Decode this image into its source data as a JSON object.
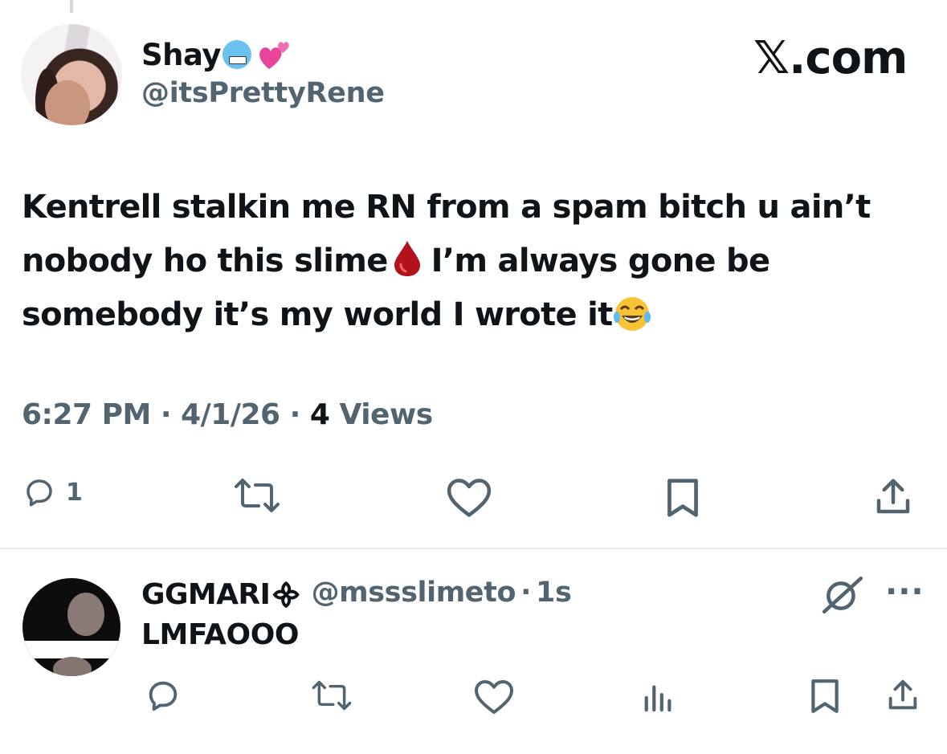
{
  "header": {
    "display_name": "Shay",
    "display_name_emojis": [
      "cold-face-emoji",
      "two-hearts-emoji"
    ],
    "handle": "@itsPrettyRene",
    "watermark": "𝕏.com"
  },
  "tweet": {
    "lines": [
      "Kentrell stalkin me RN from a spam bitch u ain’t",
      "nobody ho this slime",
      "I’m always gone be",
      "somebody it’s my world I wrote it"
    ],
    "inline_emojis": [
      "drop-of-blood-emoji",
      "tears-of-joy-emoji"
    ],
    "time": "6:27 PM",
    "date": "4/1/26",
    "separator": "·",
    "views_count": "4",
    "views_label": "Views"
  },
  "actions": {
    "reply_count": "1"
  },
  "reply": {
    "display_name": "GGMARI᯽",
    "handle": "@mssslimeto",
    "separator": "·",
    "time": "1s",
    "text": "LMFAOOO",
    "more_label": "···"
  },
  "colors": {
    "text": "#0f1419",
    "secondary": "#536471",
    "divider": "#e7eaec",
    "background": "#ffffff"
  }
}
